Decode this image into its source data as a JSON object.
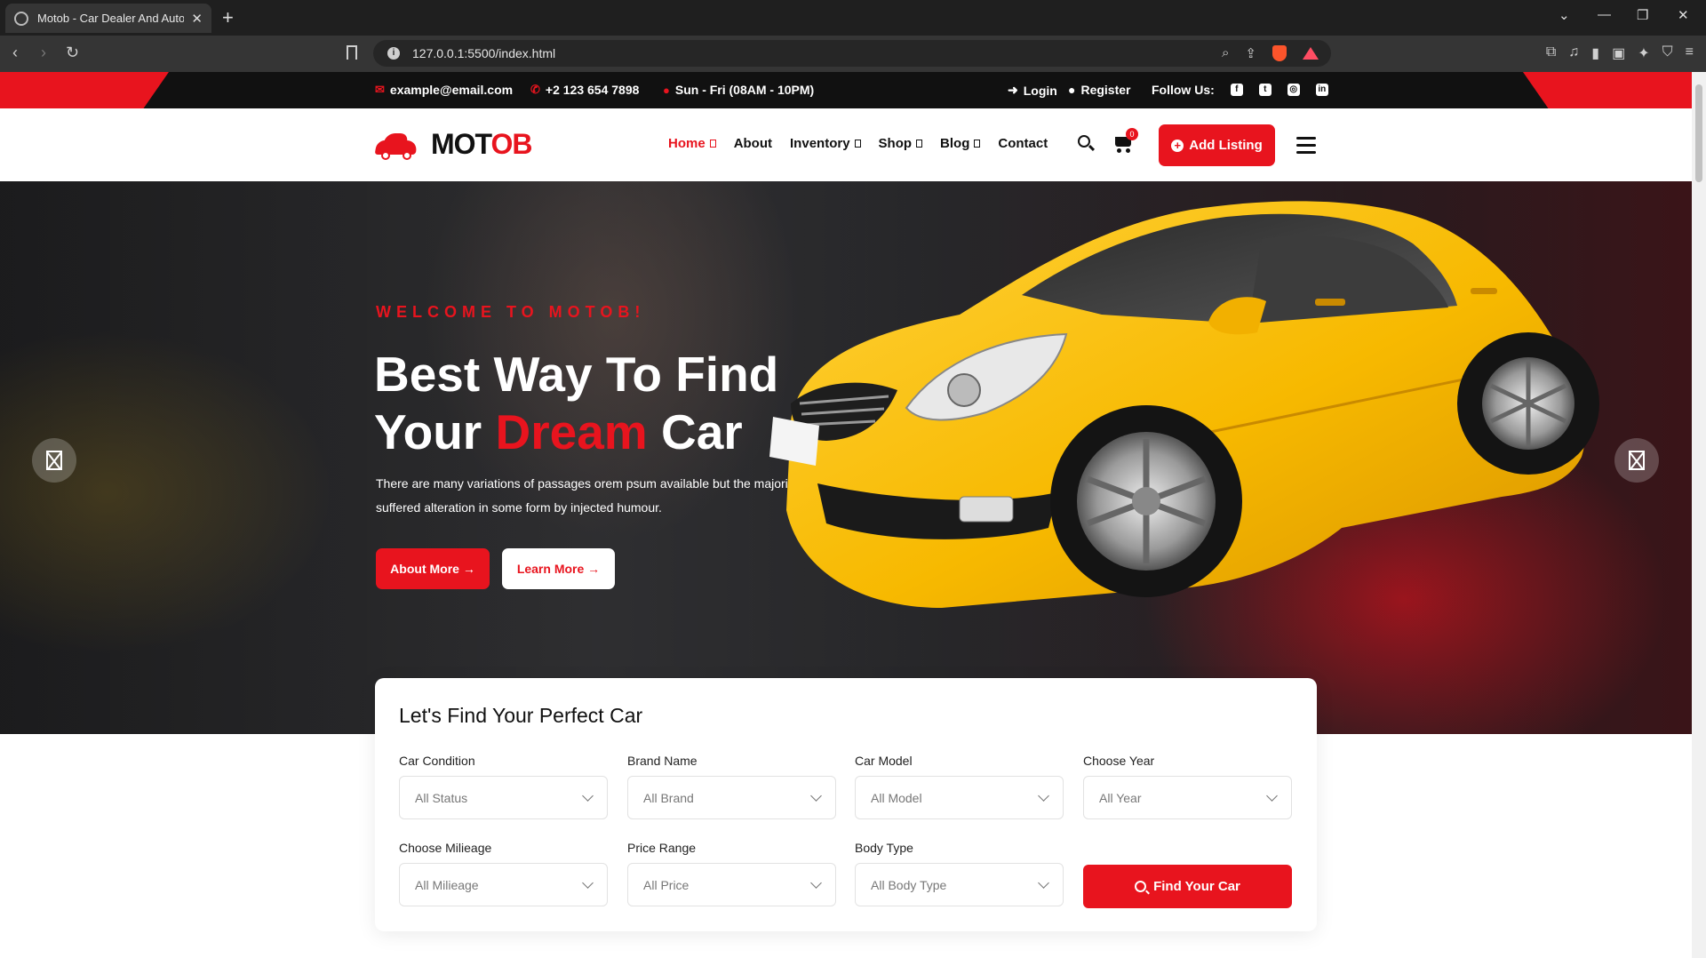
{
  "browser": {
    "tab_title": "Motob - Car Dealer And Autom",
    "url": "127.0.0.1:5500/index.html"
  },
  "topbar": {
    "email": "example@email.com",
    "phone": "+2 123 654 7898",
    "hours": "Sun - Fri (08AM - 10PM)",
    "login": "Login",
    "register": "Register",
    "follow_label": "Follow Us:",
    "social_icons": [
      "facebook-icon",
      "twitter-icon",
      "instagram-icon",
      "linkedin-icon"
    ]
  },
  "header": {
    "logo_main": "MOT",
    "logo_accent": "OB",
    "nav": [
      {
        "label": "Home",
        "dropdown": true,
        "active": true
      },
      {
        "label": "About",
        "dropdown": false
      },
      {
        "label": "Inventory",
        "dropdown": true
      },
      {
        "label": "Shop",
        "dropdown": true
      },
      {
        "label": "Blog",
        "dropdown": true
      },
      {
        "label": "Contact",
        "dropdown": false
      }
    ],
    "cart_count": "0",
    "add_listing": "Add Listing"
  },
  "hero": {
    "subtitle": "WELCOME TO MOTOB!",
    "title_line1": "Best Way To Find",
    "title_part1": "Your ",
    "title_accent": "Dream",
    "title_part2": " Car",
    "description": "There are many variations of passages orem psum available but the majority have suffered alteration in some form by injected humour.",
    "btn_about": "About More →",
    "btn_learn": "Learn More →"
  },
  "search": {
    "title": "Let's Find Your Perfect Car",
    "fields": [
      {
        "label": "Car Condition",
        "value": "All Status"
      },
      {
        "label": "Brand Name",
        "value": "All Brand"
      },
      {
        "label": "Car Model",
        "value": "All Model"
      },
      {
        "label": "Choose Year",
        "value": "All Year"
      },
      {
        "label": "Choose Milieage",
        "value": "All Milieage"
      },
      {
        "label": "Price Range",
        "value": "All Price"
      },
      {
        "label": "Body Type",
        "value": "All Body Type"
      }
    ],
    "submit": "Find Your Car"
  },
  "colors": {
    "accent": "#e8141e",
    "dark": "#111111",
    "car_yellow": "#f7b900"
  }
}
